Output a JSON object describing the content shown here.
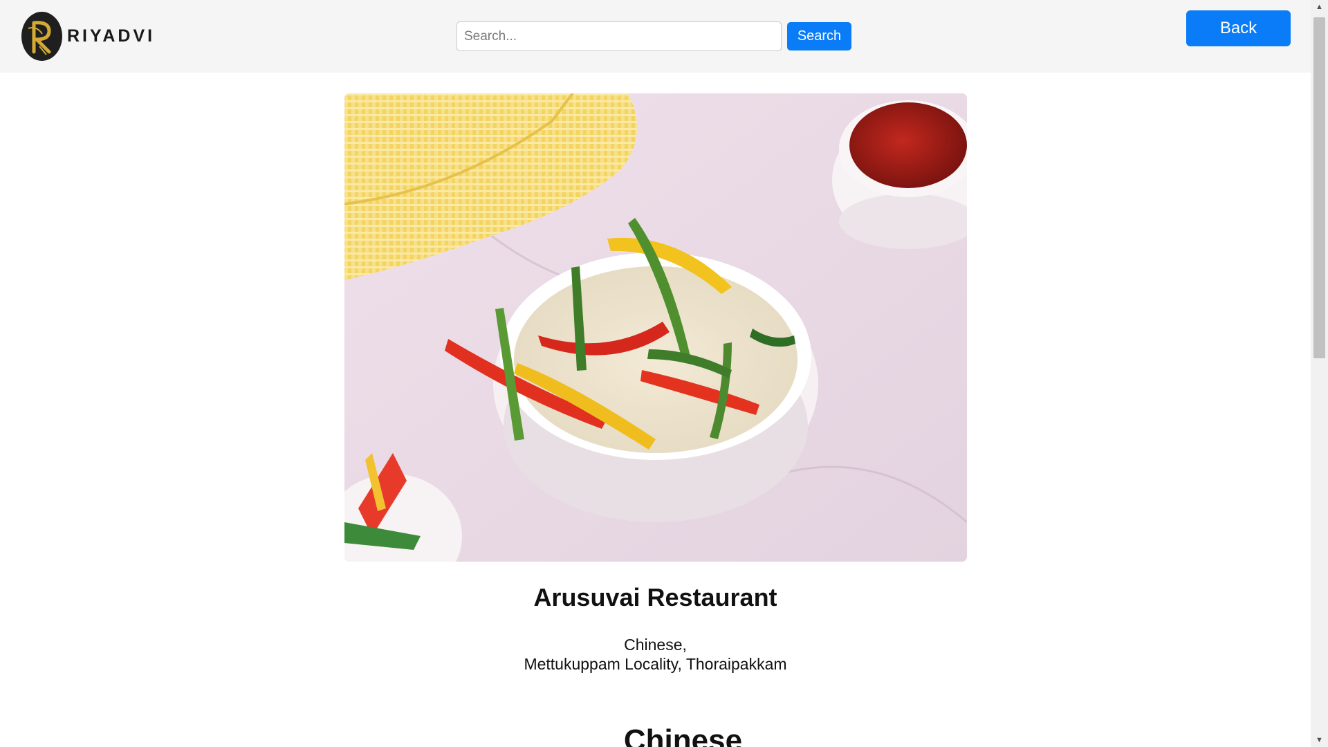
{
  "header": {
    "brand_name": "RIYADVI",
    "search": {
      "placeholder": "Search...",
      "value": ""
    },
    "search_button_label": "Search",
    "back_button_label": "Back"
  },
  "hero": {
    "icon": "food-photo-fried-rice"
  },
  "restaurant": {
    "name": "Arusuvai Restaurant",
    "cuisine": "Chinese,",
    "location": "Mettukuppam Locality, Thoraipakkam"
  },
  "menu": {
    "section_title": "Chinese"
  },
  "colors": {
    "accent": "#0a7cf7",
    "header_bg": "#f5f5f5",
    "logo_bg": "#1f1f1f",
    "logo_gold": "#d4a934"
  }
}
